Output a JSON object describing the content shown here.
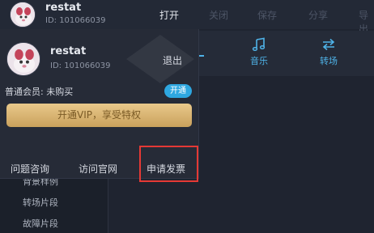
{
  "header": {
    "username": "restat",
    "user_id": "ID: 101066039",
    "menu": [
      {
        "label": "打开"
      },
      {
        "label": "关闭"
      },
      {
        "label": "保存"
      },
      {
        "label": "分享"
      },
      {
        "label": "导出"
      }
    ]
  },
  "toolbar": {
    "music_label": "音乐",
    "transition_label": "转场"
  },
  "sidebar": {
    "items": [
      {
        "label": "背景样例"
      },
      {
        "label": "转场片段"
      },
      {
        "label": "故障片段"
      }
    ]
  },
  "popup": {
    "username": "restat",
    "user_id": "ID: 101066039",
    "logout_label": "退出",
    "member_status": "普通会员: 未购买",
    "open_label": "开通",
    "vip_label": "开通VIP，享受特权",
    "links": [
      {
        "label": "问题咨询"
      },
      {
        "label": "访问官网"
      },
      {
        "label": "申请发票"
      }
    ]
  },
  "colors": {
    "accent": "#2ea7e0",
    "highlight_box": "#e53935",
    "vip_gold": "#d9b571"
  }
}
